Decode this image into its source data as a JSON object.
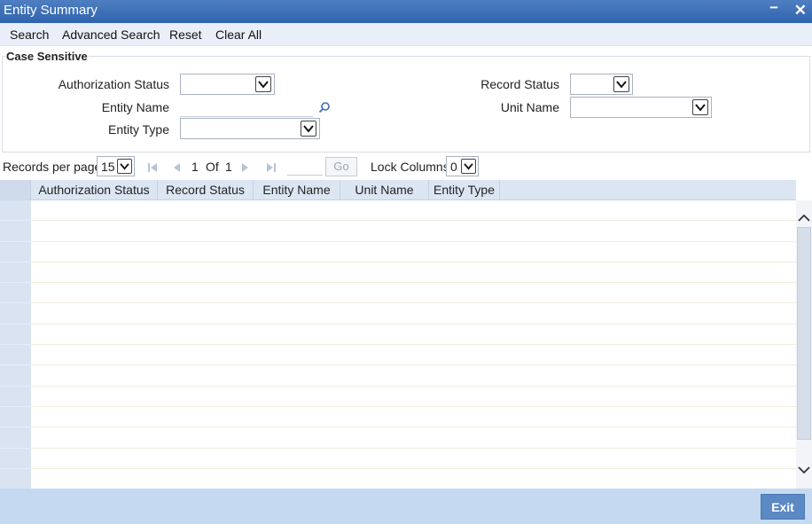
{
  "window": {
    "title": "Entity Summary",
    "minimize_glyph": "−",
    "close_glyph": "✕"
  },
  "menu": {
    "items": [
      "Search",
      "Advanced Search",
      "Reset",
      "Clear All"
    ]
  },
  "criteria": {
    "legend": "Case Sensitive",
    "fields": {
      "authorization_status": {
        "label": "Authorization Status",
        "value": ""
      },
      "entity_name": {
        "label": "Entity Name",
        "value": ""
      },
      "entity_type": {
        "label": "Entity Type",
        "value": ""
      },
      "record_status": {
        "label": "Record Status",
        "value": ""
      },
      "unit_name": {
        "label": "Unit Name",
        "value": ""
      }
    }
  },
  "pager": {
    "records_label": "Records per page",
    "records_value": "15",
    "current_page": "1",
    "of_label": "Of",
    "total_pages": "1",
    "go_label": "Go",
    "lock_label": "Lock Columns",
    "lock_value": "0"
  },
  "grid": {
    "columns": [
      "Authorization Status",
      "Record Status",
      "Entity Name",
      "Unit Name",
      "Entity Type"
    ],
    "rows": []
  },
  "footer": {
    "exit_label": "Exit"
  },
  "colors": {
    "title_bar": "#3a6db5",
    "menu_bar": "#e9eff8",
    "footer": "#c5daf0",
    "button": "#5b89c3"
  },
  "icons": [
    "minimize-icon",
    "close-icon",
    "chevron-down-icon",
    "search-icon",
    "first-page-icon",
    "prev-page-icon",
    "next-page-icon",
    "last-page-icon",
    "scroll-up-icon",
    "scroll-down-icon"
  ]
}
